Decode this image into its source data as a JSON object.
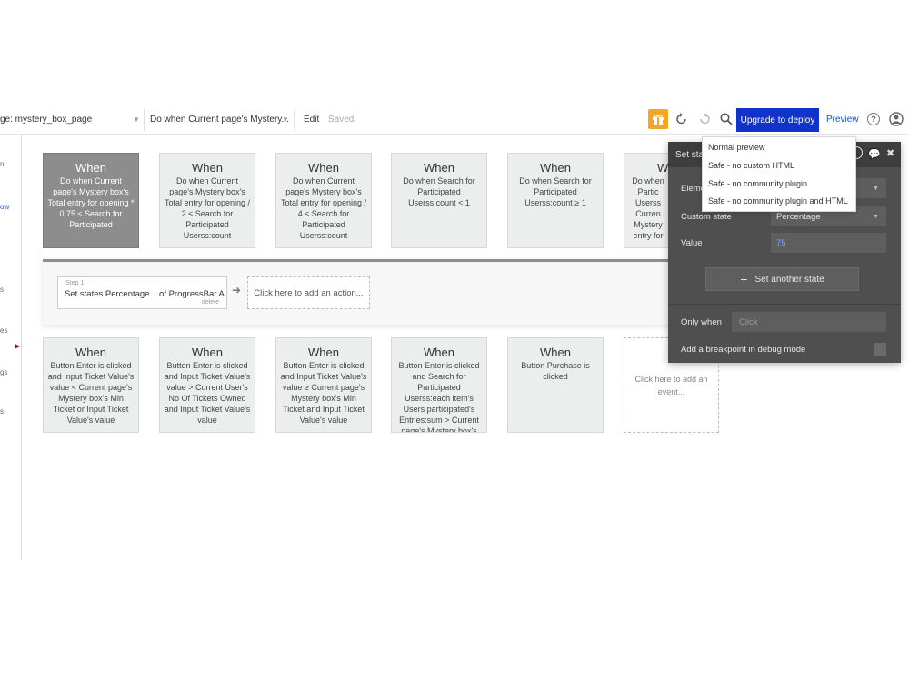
{
  "topbar": {
    "page_selector": "ge: mystery_box_page",
    "workflow_selector": "Do when Current page's Mystery...",
    "edit_label": "Edit",
    "saved_label": "Saved",
    "upgrade_label": "Upgrade to deploy",
    "preview_label": "Preview",
    "help_glyph": "?"
  },
  "sidebar": {
    "items": [
      "n",
      "ow",
      "s",
      "es",
      "gs",
      "s"
    ]
  },
  "events_row1": [
    {
      "when": "When",
      "condition": "Do when Current page's Mystery box's Total entry for opening * 0.75 ≤ Search for Participated"
    },
    {
      "when": "When",
      "condition": "Do when Current page's Mystery box's Total entry for opening / 2 ≤ Search for Participated Userss:count"
    },
    {
      "when": "When",
      "condition": "Do when Current page's Mystery box's Total entry for opening / 4 ≤ Search for Participated Userss:count"
    },
    {
      "when": "When",
      "condition": "Do when Search for Participated Userss:count < 1"
    },
    {
      "when": "When",
      "condition": "Do when Search for Participated Userss:count ≥ 1"
    },
    {
      "when": "W",
      "condition": "Do when Partic Userss Curren Mystery entry for"
    }
  ],
  "action": {
    "step_label": "Step 1",
    "step_text": "Set states Percentage... of ProgressBar A",
    "delete_label": "delete",
    "add_action_label": "Click here to add an action..."
  },
  "events_row2": [
    {
      "when": "When",
      "condition": "Button Enter is clicked and Input Ticket Value's value < Current page's Mystery box's Min Ticket or Input Ticket Value's value"
    },
    {
      "when": "When",
      "condition": "Button Enter is clicked and Input Ticket Value's value > Current User's No Of Tickets Owned and Input Ticket Value's value"
    },
    {
      "when": "When",
      "condition": "Button Enter is clicked and Input Ticket Value's value ≥ Current page's Mystery box's Min Ticket and Input Ticket Value's value"
    },
    {
      "when": "When",
      "condition": "Button Enter is clicked and Search for Participated Userss:each item's Users participated's Entries:sum > Current page's Mystery box's"
    },
    {
      "when": "When",
      "condition": "Button Purchase is clicked"
    }
  ],
  "add_event_label": "Click here to add an event...",
  "panel": {
    "title": "Set sta",
    "element_label": "Eleme",
    "custom_state_label": "Custom state",
    "custom_state_value": "Percentage",
    "value_label": "Value",
    "value_value": "75",
    "set_another_label": "Set another state",
    "only_when_label": "Only when",
    "only_when_placeholder": "Click",
    "breakpoint_label": "Add a breakpoint in debug mode"
  },
  "preview_menu": {
    "items": [
      "Normal preview",
      "Safe - no custom HTML",
      "Safe - no community plugin",
      "Safe - no community plugin and HTML"
    ]
  },
  "colors": {
    "accent": "#1133cc",
    "gift": "#f5a623",
    "panel": "#4f4f4f",
    "selected_card": "#8d8d8d"
  }
}
